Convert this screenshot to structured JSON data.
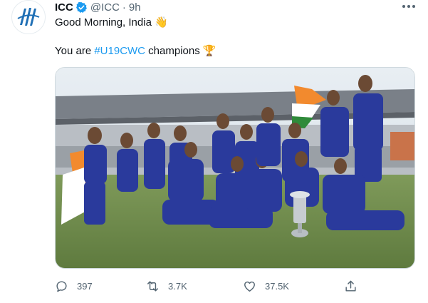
{
  "tweet": {
    "author_name": "ICC",
    "author_handle": "@ICC",
    "separator": "·",
    "timestamp": "9h",
    "text_line1": "Good Morning, India",
    "text_line1_emoji": "👋",
    "text_line2_prefix": "You are ",
    "hashtag": "#U19CWC",
    "text_line2_suffix": " champions",
    "text_line2_emoji": "🏆"
  },
  "actions": {
    "reply_count": "397",
    "retweet_count": "3.7K",
    "like_count": "37.5K"
  },
  "icons": {
    "avatar": "icc-logo-icon",
    "verified": "verified-badge-icon",
    "more": "more-options-icon",
    "reply": "reply-icon",
    "retweet": "retweet-icon",
    "like": "heart-icon",
    "share": "share-icon"
  },
  "colors": {
    "accent": "#1d9bf0",
    "muted": "#536471",
    "text": "#0f1419",
    "jersey": "#2a3a9c"
  }
}
